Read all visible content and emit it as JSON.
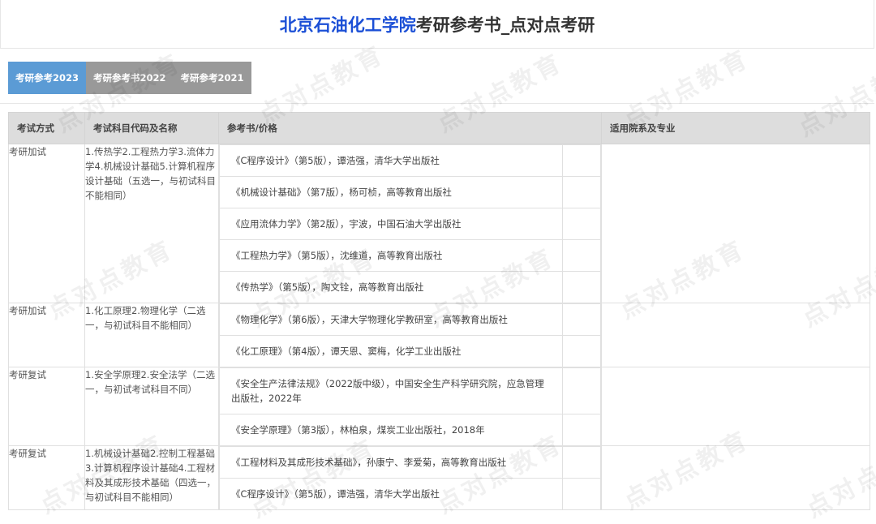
{
  "header": {
    "school": "北京石油化工学院",
    "rest": "考研参考书_点对点考研"
  },
  "tabs": [
    {
      "label": "考研参考2023",
      "active": true
    },
    {
      "label": "考研参考书2022",
      "active": false
    },
    {
      "label": "考研参考2021",
      "active": false
    }
  ],
  "table": {
    "headers": [
      "考试方式",
      "考试科目代码及名称",
      "参考书/价格",
      "适用院系及专业"
    ],
    "rows": [
      {
        "method": "考研加试",
        "subject": "1.传热学2.工程热力学3.流体力学4.机械设计基础5.计算机程序设计基础（五选一，与初试科目不能相同）",
        "books": [
          "《C程序设计》（第5版），谭浩强，清华大学出版社",
          "《机械设计基础》（第7版），杨可桢，高等教育出版社",
          "《应用流体力学》（第2版），宇波，中国石油大学出版社",
          "《工程热力学》（第5版），沈维道，高等教育出版社",
          "《传热学》（第5版），陶文铨，高等教育出版社"
        ],
        "dept": ""
      },
      {
        "method": "考研加试",
        "subject": "1.化工原理2.物理化学（二选一，与初试科目不能相同）",
        "books": [
          "《物理化学》（第6版），天津大学物理化学教研室，高等教育出版社",
          "《化工原理》（第4版），谭天恩、窦梅，化学工业出版社"
        ],
        "dept": ""
      },
      {
        "method": "考研复试",
        "subject": "1.安全学原理2.安全法学（二选一，与初试考试科目不同）",
        "books": [
          "《安全生产法律法规》（2022版中级），中国安全生产科学研究院，应急管理出版社，2022年",
          "《安全学原理》（第3版），林柏泉，煤炭工业出版社，2018年"
        ],
        "dept": ""
      },
      {
        "method": "考研复试",
        "subject": "1.机械设计基础2.控制工程基础3.计算机程序设计基础4.工程材料及其成形技术基础（四选一，与初试科目不能相同）",
        "books": [
          "《工程材料及其成形技术基础》，孙康宁、李爱菊，高等教育出版社",
          "《C程序设计》（第5版），谭浩强，清华大学出版社"
        ],
        "dept": ""
      }
    ]
  },
  "watermark": "点对点教育"
}
